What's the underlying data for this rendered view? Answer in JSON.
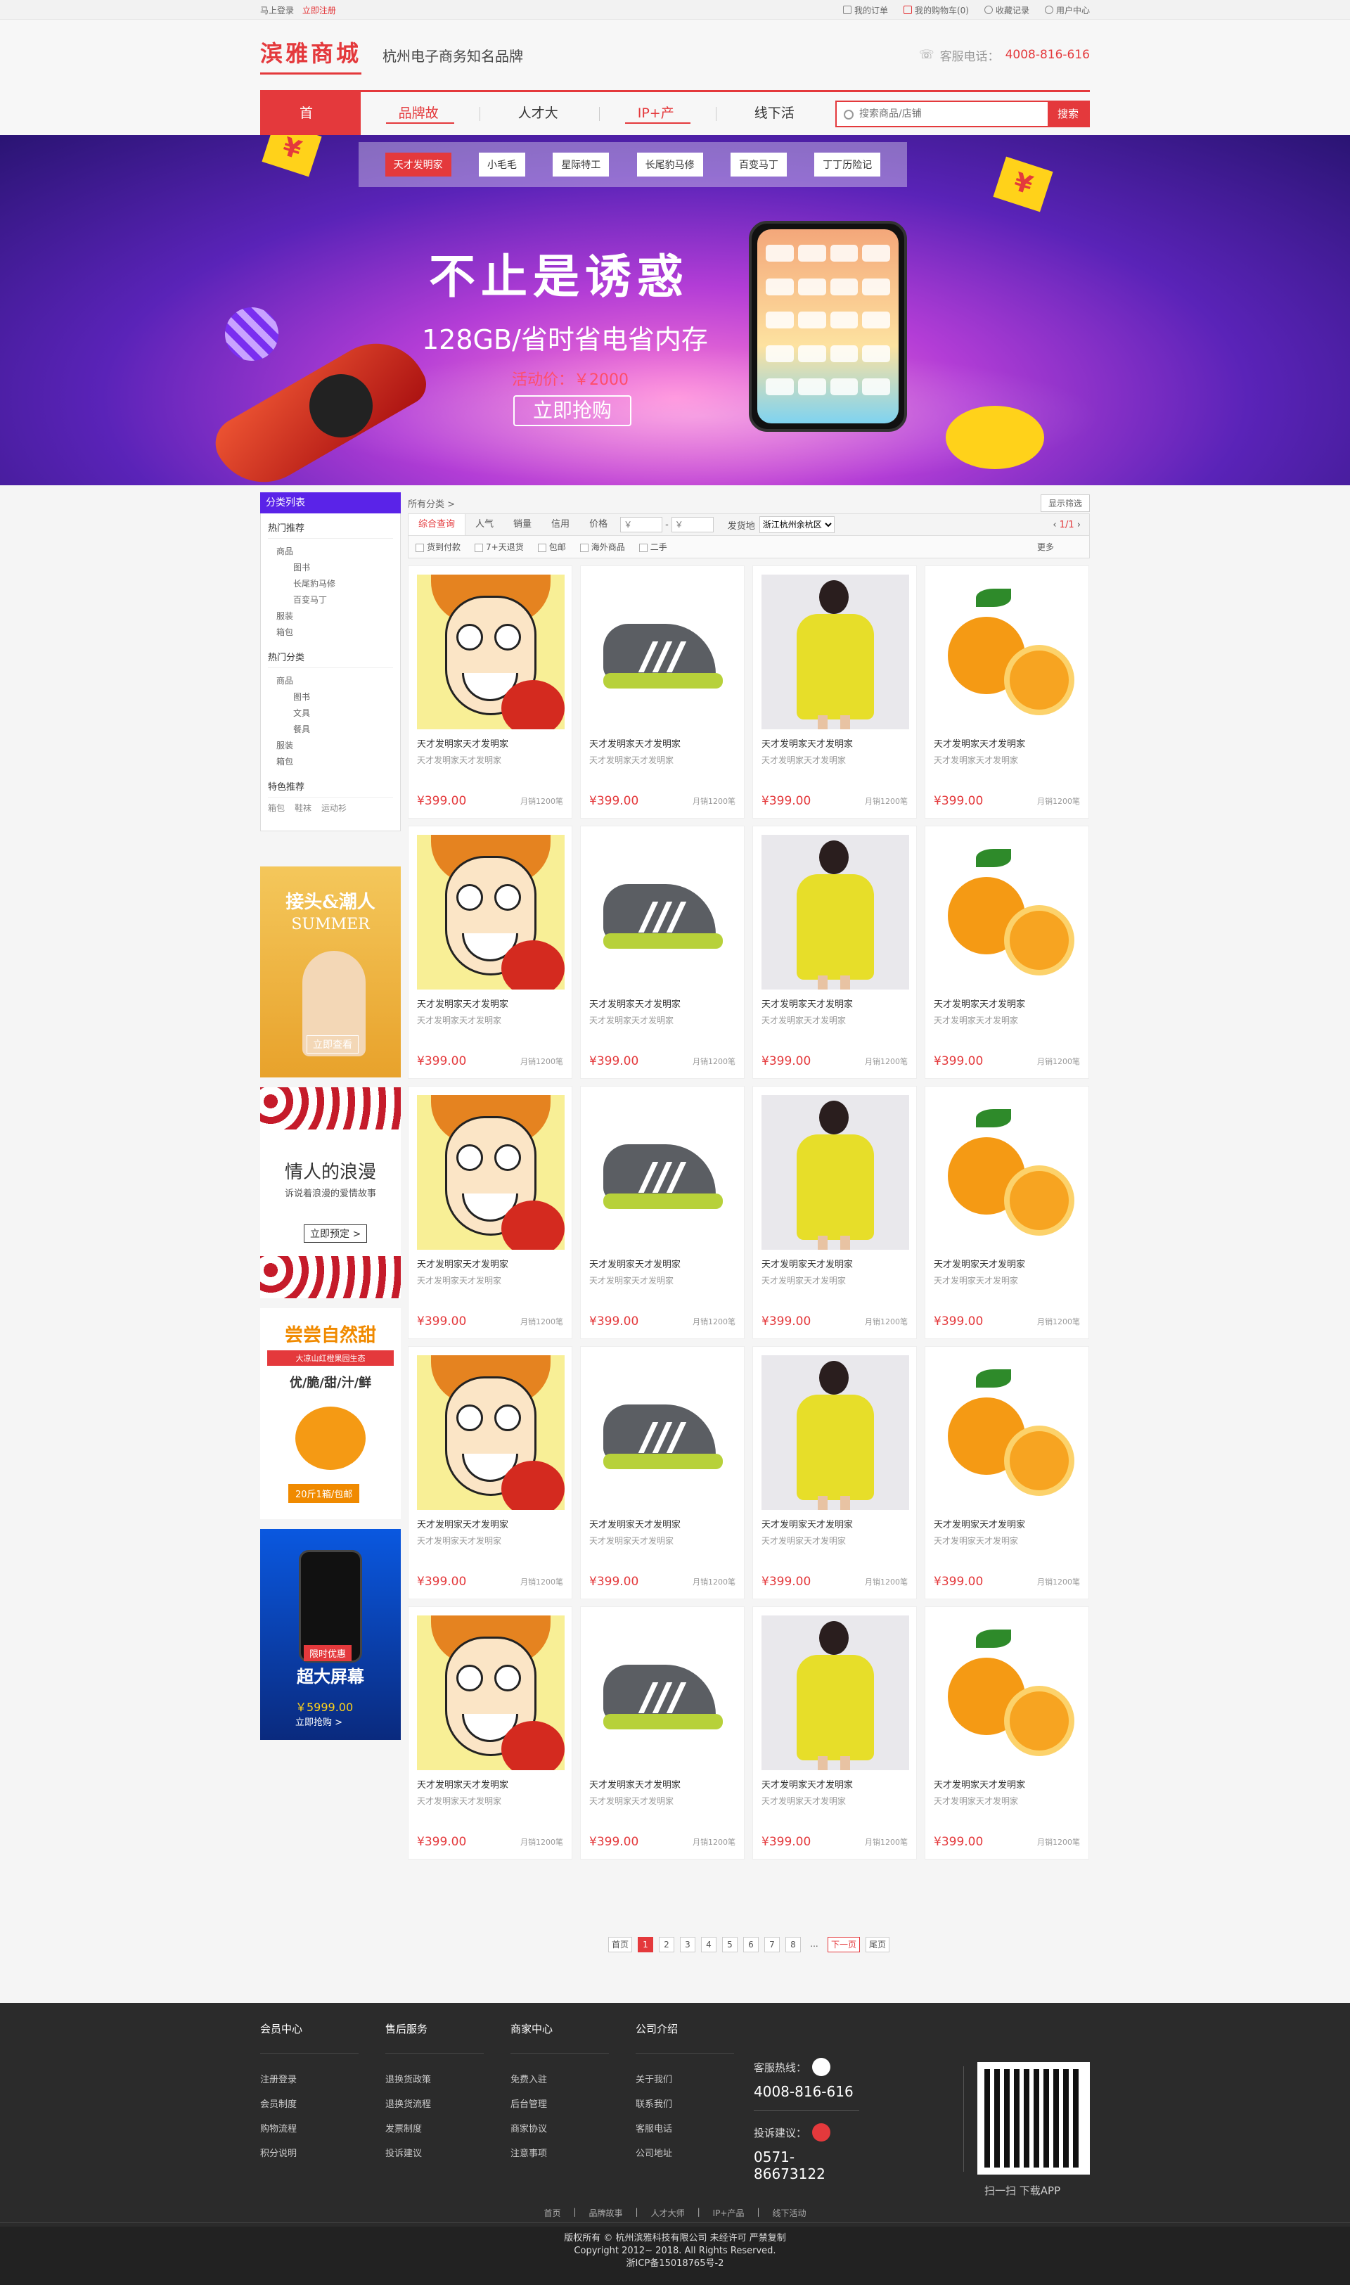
{
  "topbar": {
    "login": "马上登录",
    "register": "立即注册",
    "orders": "我的订单",
    "cart": "我的购物车(0)",
    "favorites": "收藏记录",
    "user_center": "用户中心"
  },
  "header": {
    "logo": "滨雅商城",
    "slogan": "杭州电子商务知名品牌",
    "hotline_label": "客服电话：",
    "hotline": "4008-816-616"
  },
  "nav": {
    "items": [
      "首页",
      "品牌故事",
      "人才大师",
      "IP+产品",
      "线下活动"
    ],
    "search_placeholder": "搜索商品/店铺",
    "search_button": "搜索"
  },
  "banner": {
    "tags": [
      "天才发明家",
      "小毛毛",
      "星际特工",
      "长尾豹马修",
      "百变马丁",
      "丁丁历险记"
    ],
    "title": "不止是诱惑",
    "subtitle": "128GB/省时省电省内存",
    "price": "活动价：￥2000",
    "button": "立即抢购"
  },
  "sidebar": {
    "title": "分类列表",
    "hot_recommend": {
      "title": "热门推荐",
      "items": [
        "商品",
        "图书",
        "长尾豹马修",
        "百变马丁",
        "服装",
        "箱包"
      ]
    },
    "hot_category": {
      "title": "热门分类",
      "items": [
        "商品",
        "图书",
        "文具",
        "餐具",
        "服装",
        "箱包"
      ]
    },
    "special": {
      "title": "特色推荐",
      "items": [
        "箱包",
        "鞋袜",
        "运动衫"
      ]
    }
  },
  "ads": [
    {
      "title": "接头&潮人",
      "sub": "SUMMER",
      "button": "立即查看"
    },
    {
      "title": "情人的浪漫",
      "sub": "诉说着浪漫的爱情故事",
      "button": "立即预定 >"
    },
    {
      "title": "尝尝自然甜",
      "tag": "大凉山红橙果园生态",
      "sub": "优/脆/甜/汁/鲜",
      "button": "20斤1箱/包邮"
    },
    {
      "title": "超大屏幕",
      "tag": "限时优惠",
      "price": "￥5999.00",
      "button": "立即抢购 >"
    }
  ],
  "content": {
    "breadcrumb": "所有分类 >",
    "filter_toggle": "显示筛选",
    "sort": [
      "综合查询",
      "人气",
      "销量",
      "信用",
      "价格"
    ],
    "price_from": "￥",
    "price_to": "￥",
    "ship_label": "发货地",
    "ship_value": "浙江杭州余杭区",
    "pageinfo": "1/1",
    "filters": [
      "货到付款",
      "7+天退货",
      "包邮",
      "海外商品",
      "二手"
    ],
    "more": "更多"
  },
  "products": [
    {
      "img": "cartoon",
      "name": "天才发明家天才发明家",
      "desc": "天才发明家天才发明家",
      "price": "¥399.00",
      "sold": "月销1200笔"
    },
    {
      "img": "shoe",
      "name": "天才发明家天才发明家",
      "desc": "天才发明家天才发明家",
      "price": "¥399.00",
      "sold": "月销1200笔"
    },
    {
      "img": "dress",
      "name": "天才发明家天才发明家",
      "desc": "天才发明家天才发明家",
      "price": "¥399.00",
      "sold": "月销1200笔"
    },
    {
      "img": "orange",
      "name": "天才发明家天才发明家",
      "desc": "天才发明家天才发明家",
      "price": "¥399.00",
      "sold": "月销1200笔"
    },
    {
      "img": "cartoon",
      "name": "天才发明家天才发明家",
      "desc": "天才发明家天才发明家",
      "price": "¥399.00",
      "sold": "月销1200笔"
    },
    {
      "img": "shoe",
      "name": "天才发明家天才发明家",
      "desc": "天才发明家天才发明家",
      "price": "¥399.00",
      "sold": "月销1200笔"
    },
    {
      "img": "dress",
      "name": "天才发明家天才发明家",
      "desc": "天才发明家天才发明家",
      "price": "¥399.00",
      "sold": "月销1200笔"
    },
    {
      "img": "orange",
      "name": "天才发明家天才发明家",
      "desc": "天才发明家天才发明家",
      "price": "¥399.00",
      "sold": "月销1200笔"
    },
    {
      "img": "cartoon",
      "name": "天才发明家天才发明家",
      "desc": "天才发明家天才发明家",
      "price": "¥399.00",
      "sold": "月销1200笔"
    },
    {
      "img": "shoe",
      "name": "天才发明家天才发明家",
      "desc": "天才发明家天才发明家",
      "price": "¥399.00",
      "sold": "月销1200笔"
    },
    {
      "img": "dress",
      "name": "天才发明家天才发明家",
      "desc": "天才发明家天才发明家",
      "price": "¥399.00",
      "sold": "月销1200笔"
    },
    {
      "img": "orange",
      "name": "天才发明家天才发明家",
      "desc": "天才发明家天才发明家",
      "price": "¥399.00",
      "sold": "月销1200笔"
    },
    {
      "img": "cartoon",
      "name": "天才发明家天才发明家",
      "desc": "天才发明家天才发明家",
      "price": "¥399.00",
      "sold": "月销1200笔"
    },
    {
      "img": "shoe",
      "name": "天才发明家天才发明家",
      "desc": "天才发明家天才发明家",
      "price": "¥399.00",
      "sold": "月销1200笔"
    },
    {
      "img": "dress",
      "name": "天才发明家天才发明家",
      "desc": "天才发明家天才发明家",
      "price": "¥399.00",
      "sold": "月销1200笔"
    },
    {
      "img": "orange",
      "name": "天才发明家天才发明家",
      "desc": "天才发明家天才发明家",
      "price": "¥399.00",
      "sold": "月销1200笔"
    },
    {
      "img": "cartoon",
      "name": "天才发明家天才发明家",
      "desc": "天才发明家天才发明家",
      "price": "¥399.00",
      "sold": "月销1200笔"
    },
    {
      "img": "shoe",
      "name": "天才发明家天才发明家",
      "desc": "天才发明家天才发明家",
      "price": "¥399.00",
      "sold": "月销1200笔"
    },
    {
      "img": "dress",
      "name": "天才发明家天才发明家",
      "desc": "天才发明家天才发明家",
      "price": "¥399.00",
      "sold": "月销1200笔"
    },
    {
      "img": "orange",
      "name": "天才发明家天才发明家",
      "desc": "天才发明家天才发明家",
      "price": "¥399.00",
      "sold": "月销1200笔"
    }
  ],
  "pager": {
    "first": "首页",
    "pages": [
      "1",
      "2",
      "3",
      "4",
      "5",
      "6",
      "7",
      "8"
    ],
    "current": "1",
    "dots": "...",
    "next": "下一页",
    "last": "尾页"
  },
  "footer": {
    "cols": [
      {
        "title": "会员中心",
        "items": [
          "注册登录",
          "会员制度",
          "购物流程",
          "积分说明"
        ]
      },
      {
        "title": "售后服务",
        "items": [
          "退换货政策",
          "退换货流程",
          "发票制度",
          "投诉建议"
        ]
      },
      {
        "title": "商家中心",
        "items": [
          "免费入驻",
          "后台管理",
          "商家协议",
          "注意事项"
        ]
      },
      {
        "title": "公司介绍",
        "items": [
          "关于我们",
          "联系我们",
          "客服电话",
          "公司地址"
        ]
      }
    ],
    "hotline_label": "客服热线：",
    "hotline": "4008-816-616",
    "complaint_label": "投诉建议：",
    "complaint": "0571-86673122",
    "qr_label": "扫一扫  下载APP",
    "links": [
      "首页",
      "品牌故事",
      "人才大师",
      "IP+产品",
      "线下活动"
    ],
    "copyright": [
      "版权所有 © 杭州滨雅科技有限公司 未经许可 严禁复制",
      "Copyright 2012~ 2018. All Rights Reserved.",
      "浙ICP备15018765号-2"
    ]
  },
  "colors": {
    "accent": "#e4393c",
    "sidebar_head": "#5a23e8",
    "footer_bg": "#2b2b2b"
  }
}
